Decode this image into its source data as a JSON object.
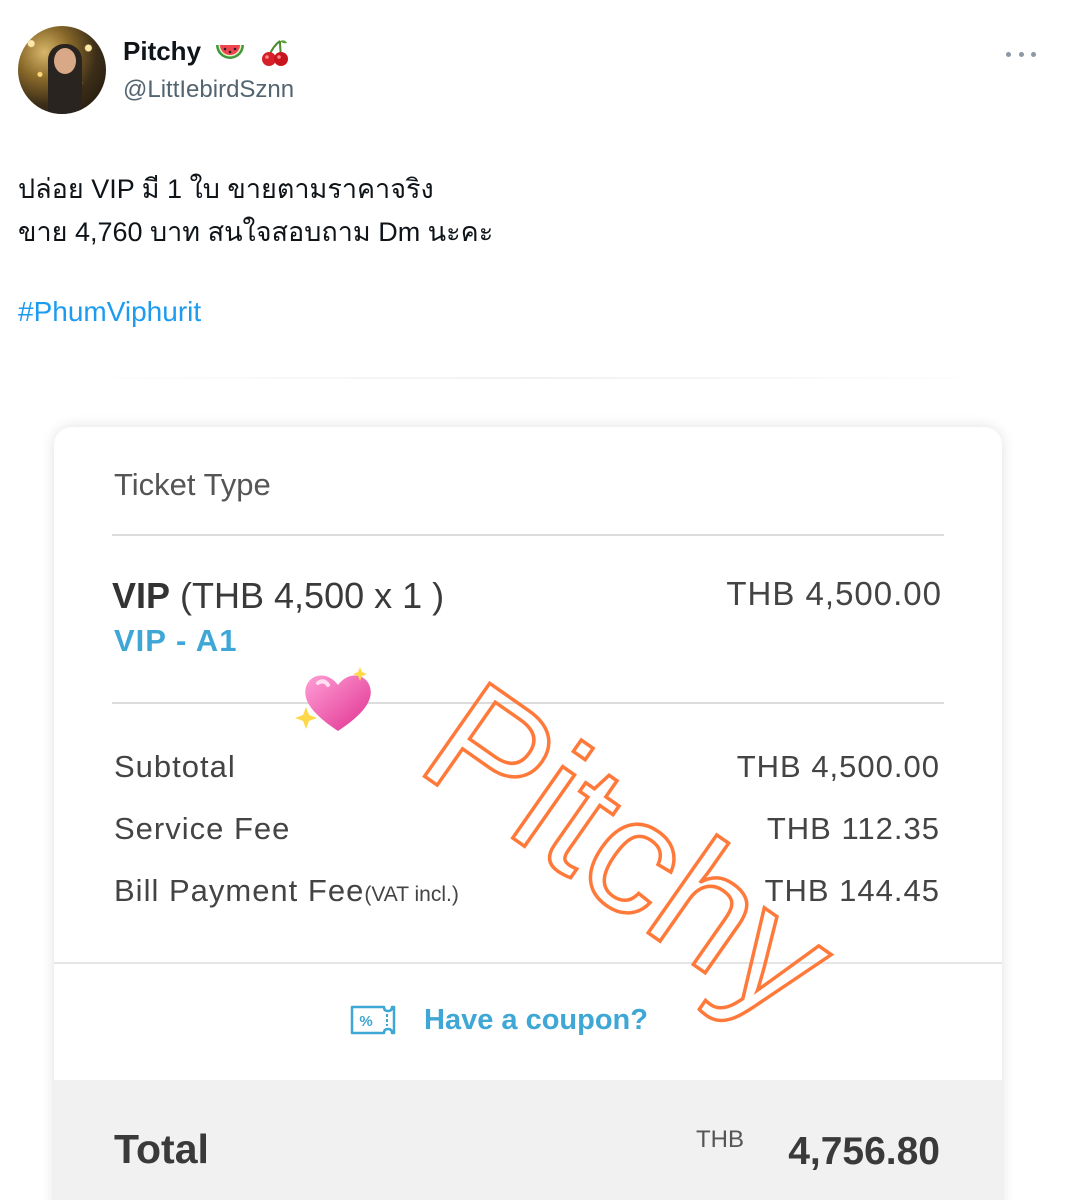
{
  "tweet": {
    "display_name": "Pitchy",
    "username": "@LittIebirdSznn",
    "line1": "ปล่อย VIP มี 1 ใบ ขายตามราคาจริง",
    "line2": "ขาย 4,760 บาท สนใจสอบถาม Dm นะคะ",
    "hashtag": "#PhumViphurit"
  },
  "ticket": {
    "header": "Ticket Type",
    "item_name": "VIP",
    "item_detail": "(THB 4,500 x 1 )",
    "item_amount": "THB 4,500.00",
    "seat": "VIP - A1",
    "rows": [
      {
        "label": "Subtotal",
        "value": "THB 4,500.00"
      },
      {
        "label": "Service Fee",
        "value": "THB 112.35"
      },
      {
        "label": "Bill Payment Fee",
        "label_small": "(VAT incl.)",
        "value": "THB 144.45"
      }
    ],
    "coupon_label": "Have a coupon?",
    "total_label": "Total",
    "total_currency": "THB",
    "total_value": "4,756.80"
  },
  "watermark_text": "Pitchy",
  "icons": {
    "more": "more-dots-icon",
    "coupon": "coupon-ticket-icon",
    "heart": "sparkling-heart-icon",
    "name_emoji_1": "watermelon-icon",
    "name_emoji_2": "cherries-icon"
  },
  "colors": {
    "hashtag": "#1d9bf0",
    "accent": "#3ea7d6",
    "watermark": "#ff7a3a"
  }
}
